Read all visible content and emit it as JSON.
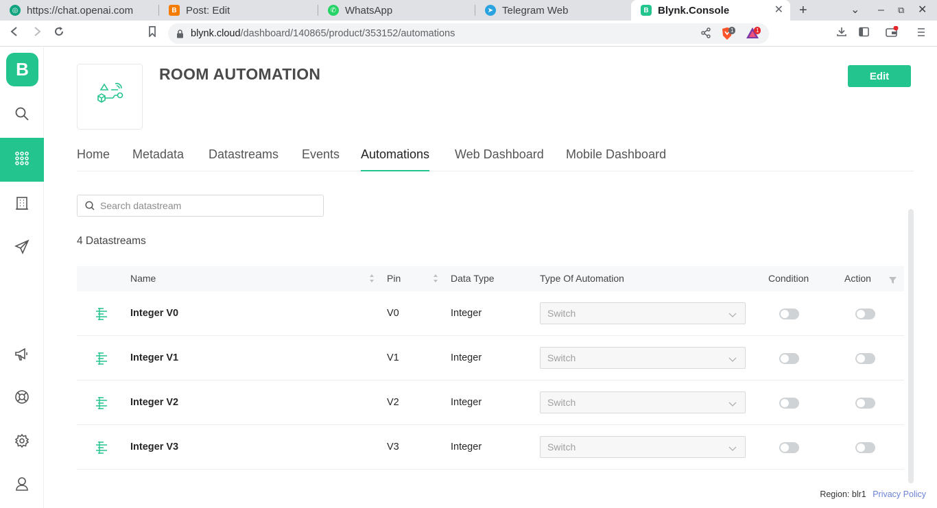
{
  "browser": {
    "tabs": [
      {
        "title": "https://chat.openai.com",
        "color": "#10a37f",
        "glyph": "◎"
      },
      {
        "title": "Post: Edit",
        "color": "#f57c00",
        "glyph": "B"
      },
      {
        "title": "WhatsApp",
        "color": "#25d366",
        "glyph": "✆"
      },
      {
        "title": "Telegram Web",
        "color": "#2aa3e0",
        "glyph": "➤"
      },
      {
        "title": "Blynk.Console",
        "color": "#23c48e",
        "glyph": "B"
      }
    ],
    "url_host": "blynk.cloud",
    "url_path": "/dashboard/140865/product/353152/automations",
    "brave_badge": "1",
    "rewards_badge": "1"
  },
  "sidebar": {
    "logo": "B",
    "items": [
      "search-icon",
      "grid-icon",
      "building-icon",
      "send-icon",
      "megaphone-icon",
      "lifebuoy-icon",
      "gear-icon",
      "user-icon"
    ]
  },
  "product": {
    "title": "ROOM AUTOMATION",
    "edit_label": "Edit"
  },
  "nav_tabs": [
    {
      "label": "Home"
    },
    {
      "label": "Metadata"
    },
    {
      "label": "Datastreams"
    },
    {
      "label": "Events"
    },
    {
      "label": "Automations",
      "active": true
    },
    {
      "label": "Web Dashboard"
    },
    {
      "label": "Mobile Dashboard"
    }
  ],
  "search": {
    "placeholder": "Search datastream"
  },
  "count_label": "4 Datastreams",
  "table": {
    "columns": {
      "name": "Name",
      "pin": "Pin",
      "data_type": "Data Type",
      "automation": "Type Of Automation",
      "condition": "Condition",
      "action": "Action"
    },
    "rows": [
      {
        "name": "Integer V0",
        "pin": "V0",
        "data_type": "Integer",
        "automation": "Switch",
        "condition": false,
        "action": false
      },
      {
        "name": "Integer V1",
        "pin": "V1",
        "data_type": "Integer",
        "automation": "Switch",
        "condition": false,
        "action": false
      },
      {
        "name": "Integer V2",
        "pin": "V2",
        "data_type": "Integer",
        "automation": "Switch",
        "condition": false,
        "action": false
      },
      {
        "name": "Integer V3",
        "pin": "V3",
        "data_type": "Integer",
        "automation": "Switch",
        "condition": false,
        "action": false
      }
    ]
  },
  "footer": {
    "region": "Region: blr1",
    "privacy": "Privacy Policy"
  },
  "colors": {
    "accent": "#23c48e",
    "link": "#6b83d6"
  }
}
